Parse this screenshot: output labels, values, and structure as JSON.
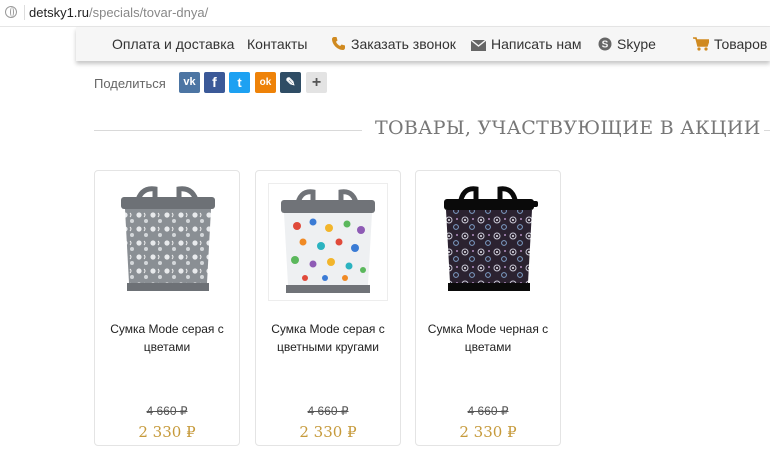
{
  "address_bar": {
    "domain": "detsky1.ru",
    "path": "/specials/tovar-dnya/"
  },
  "nav": {
    "delivery": "Оплата и доставка",
    "contacts": "Контакты",
    "call": "Заказать звонок",
    "write": "Написать нам",
    "skype": "Skype",
    "goods": "Товаров"
  },
  "share": {
    "label": "Поделиться",
    "buttons": [
      {
        "name": "vk",
        "glyph": "vk",
        "color": "#4c75a3"
      },
      {
        "name": "facebook",
        "glyph": "f",
        "color": "#3b5998"
      },
      {
        "name": "twitter",
        "glyph": "t",
        "color": "#1da1f2"
      },
      {
        "name": "odnoklassniki",
        "glyph": "ok",
        "color": "#ee8208"
      },
      {
        "name": "livejournal",
        "glyph": "✎",
        "color": "#2f4d65"
      },
      {
        "name": "more",
        "glyph": "+",
        "color": "#e3e3e3"
      }
    ]
  },
  "section": {
    "title": "ТОВАРЫ, УЧАСТВУЮЩИЕ В АКЦИИ"
  },
  "products": [
    {
      "name": "Сумка Mode серая с цветами",
      "old_price": "4 660 ₽",
      "new_price": "2 330 ₽"
    },
    {
      "name": "Сумка Mode серая с цветными кругами",
      "old_price": "4 660 ₽",
      "new_price": "2 330 ₽"
    },
    {
      "name": "Сумка Mode черная с цветами",
      "old_price": "4 660 ₽",
      "new_price": "2 330 ₽"
    }
  ],
  "colors": {
    "price_accent": "#c69a3b",
    "call_icon": "#d08a20"
  }
}
